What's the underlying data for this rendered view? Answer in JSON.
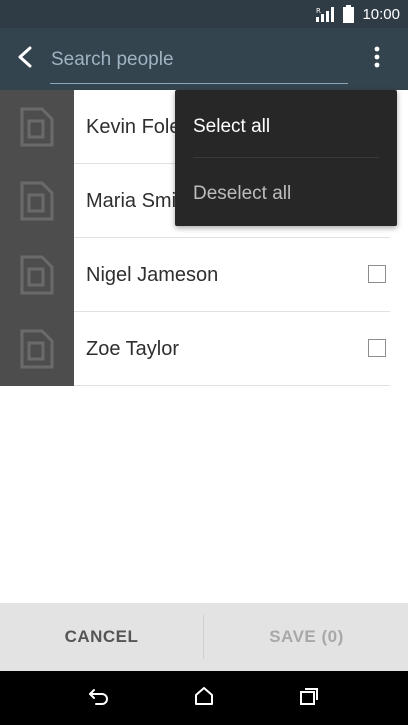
{
  "status_bar": {
    "time": "10:00",
    "signal_icon": "signal-icon",
    "battery_icon": "battery-icon"
  },
  "toolbar": {
    "back_icon": "back-chevron-icon",
    "search": {
      "placeholder": "Search people",
      "value": ""
    },
    "overflow_icon": "more-vert-icon"
  },
  "contacts": [
    {
      "name": "Kevin Foley",
      "checked": false
    },
    {
      "name": "Maria Smith",
      "checked": false
    },
    {
      "name": "Nigel Jameson",
      "checked": false
    },
    {
      "name": "Zoe Taylor",
      "checked": false
    }
  ],
  "menu": {
    "items": [
      {
        "label": "Select all"
      },
      {
        "label": "Deselect all"
      }
    ]
  },
  "actions": {
    "cancel_label": "CANCEL",
    "save_label": "SAVE (0)"
  },
  "nav": {
    "back_icon": "nav-back-icon",
    "home_icon": "nav-home-icon",
    "recents_icon": "nav-recents-icon"
  },
  "colors": {
    "app_bar": "#34444f",
    "status_bar": "#2f3b45",
    "menu_bg": "#272727",
    "thumb_bg": "#4d4d4d",
    "action_bar": "#e3e3e3"
  }
}
